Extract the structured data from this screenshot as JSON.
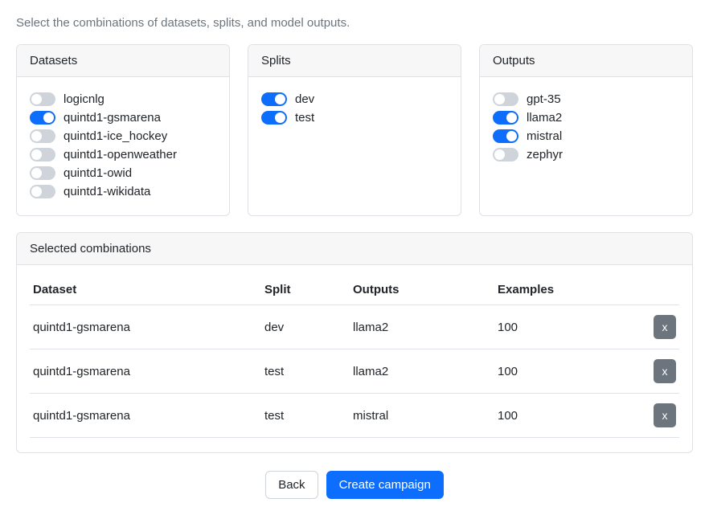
{
  "subtitle": "Select the combinations of datasets, splits, and model outputs.",
  "cards": {
    "datasets": {
      "title": "Datasets",
      "items": [
        {
          "label": "logicnlg",
          "on": false
        },
        {
          "label": "quintd1-gsmarena",
          "on": true
        },
        {
          "label": "quintd1-ice_hockey",
          "on": false
        },
        {
          "label": "quintd1-openweather",
          "on": false
        },
        {
          "label": "quintd1-owid",
          "on": false
        },
        {
          "label": "quintd1-wikidata",
          "on": false
        }
      ]
    },
    "splits": {
      "title": "Splits",
      "items": [
        {
          "label": "dev",
          "on": true
        },
        {
          "label": "test",
          "on": true
        }
      ]
    },
    "outputs": {
      "title": "Outputs",
      "items": [
        {
          "label": "gpt-35",
          "on": false
        },
        {
          "label": "llama2",
          "on": true
        },
        {
          "label": "mistral",
          "on": true
        },
        {
          "label": "zephyr",
          "on": false
        }
      ]
    }
  },
  "selected": {
    "title": "Selected combinations",
    "headers": {
      "dataset": "Dataset",
      "split": "Split",
      "outputs": "Outputs",
      "examples": "Examples"
    },
    "rows": [
      {
        "dataset": "quintd1-gsmarena",
        "split": "dev",
        "outputs": "llama2",
        "examples": "100"
      },
      {
        "dataset": "quintd1-gsmarena",
        "split": "test",
        "outputs": "llama2",
        "examples": "100"
      },
      {
        "dataset": "quintd1-gsmarena",
        "split": "test",
        "outputs": "mistral",
        "examples": "100"
      }
    ],
    "delete_label": "x"
  },
  "footer": {
    "back": "Back",
    "create": "Create campaign"
  }
}
